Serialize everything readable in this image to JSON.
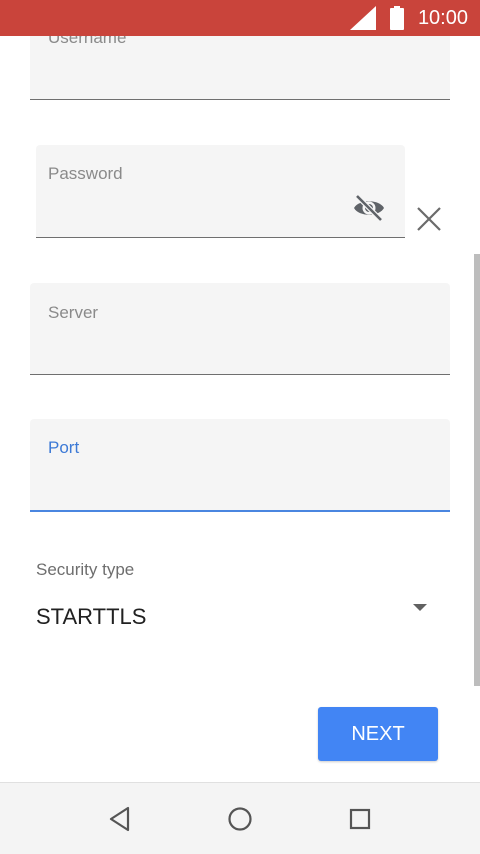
{
  "status_bar": {
    "time": "10:00",
    "color": "#c9443b",
    "icons": [
      "signal-icon",
      "battery-icon"
    ]
  },
  "form": {
    "username": {
      "label": "Username",
      "value": ""
    },
    "password": {
      "label": "Password",
      "value": "",
      "visibility_icon": "eye-off-icon",
      "clear_icon": "close-icon"
    },
    "server": {
      "label": "Server",
      "value": ""
    },
    "port": {
      "label": "Port",
      "value": "",
      "focused": true,
      "accent": "#3d7ad6"
    },
    "security": {
      "label": "Security type",
      "selected": "STARTTLS"
    }
  },
  "actions": {
    "next_label": "NEXT",
    "next_color": "#4285f4"
  },
  "nav_bar": {
    "icons": [
      "back-icon",
      "home-icon",
      "recents-icon"
    ]
  }
}
